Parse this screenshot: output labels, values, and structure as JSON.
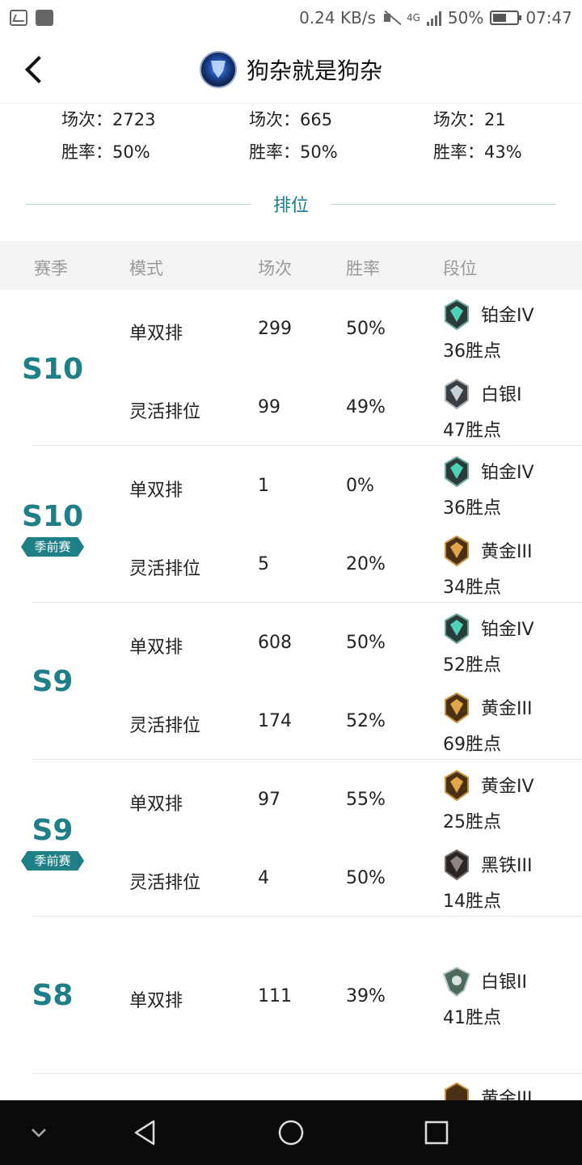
{
  "status_bar": {
    "speed": "0.24 KB/s",
    "network": "4G",
    "battery": "50%",
    "time": "07:47"
  },
  "header": {
    "title": "狗杂就是狗杂"
  },
  "summary": [
    {
      "games": "场次：2723",
      "winrate": "胜率：50%"
    },
    {
      "games": "场次：665",
      "winrate": "胜率：50%"
    },
    {
      "games": "场次：21",
      "winrate": "胜率：43%"
    }
  ],
  "section_title": "排位",
  "table_headers": {
    "season": "赛季",
    "mode": "模式",
    "games": "场次",
    "winrate": "胜率",
    "rank": "段位"
  },
  "seasons": [
    {
      "season": "S10",
      "preseason": "",
      "rows": [
        {
          "mode": "单双排",
          "games": "299",
          "winrate": "50%",
          "tier": "铂金IV",
          "points": "36胜点",
          "emblem": "platinum"
        },
        {
          "mode": "灵活排位",
          "games": "99",
          "winrate": "49%",
          "tier": "白银I",
          "points": "47胜点",
          "emblem": "silver"
        }
      ]
    },
    {
      "season": "S10",
      "preseason": "季前赛",
      "rows": [
        {
          "mode": "单双排",
          "games": "1",
          "winrate": "0%",
          "tier": "铂金IV",
          "points": "36胜点",
          "emblem": "platinum"
        },
        {
          "mode": "灵活排位",
          "games": "5",
          "winrate": "20%",
          "tier": "黄金III",
          "points": "34胜点",
          "emblem": "gold"
        }
      ]
    },
    {
      "season": "S9",
      "preseason": "",
      "rows": [
        {
          "mode": "单双排",
          "games": "608",
          "winrate": "50%",
          "tier": "铂金IV",
          "points": "52胜点",
          "emblem": "platinum"
        },
        {
          "mode": "灵活排位",
          "games": "174",
          "winrate": "52%",
          "tier": "黄金III",
          "points": "69胜点",
          "emblem": "gold"
        }
      ]
    },
    {
      "season": "S9",
      "preseason": "季前赛",
      "rows": [
        {
          "mode": "单双排",
          "games": "97",
          "winrate": "55%",
          "tier": "黄金IV",
          "points": "25胜点",
          "emblem": "gold"
        },
        {
          "mode": "灵活排位",
          "games": "4",
          "winrate": "50%",
          "tier": "黑铁III",
          "points": "14胜点",
          "emblem": "iron"
        }
      ]
    },
    {
      "season": "S8",
      "preseason": "",
      "rows": [
        {
          "mode": "单双排",
          "games": "111",
          "winrate": "39%",
          "tier": "白银II",
          "points": "41胜点",
          "emblem": "silver-old"
        }
      ]
    }
  ],
  "partial_row": {
    "tier": "黄金III"
  },
  "colors": {
    "accent": "#1f7f86",
    "header_bg": "#f3f3f3",
    "navbar_bg": "#0b0b0b"
  },
  "nav_icons": [
    "collapse-icon",
    "back-triangle-icon",
    "home-circle-icon",
    "recents-square-icon"
  ]
}
